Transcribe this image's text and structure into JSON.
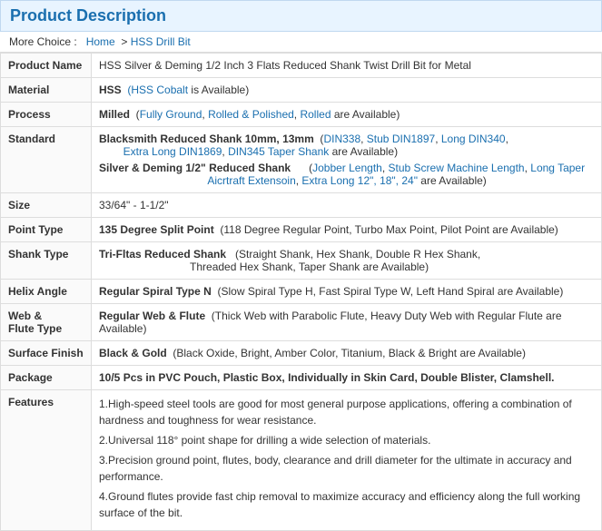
{
  "header": {
    "title": "Product Description"
  },
  "breadcrumb": {
    "prefix": "More Choice :",
    "links": [
      {
        "label": "Home",
        "href": "#"
      },
      {
        "label": "HSS Drill Bit",
        "href": "#"
      }
    ]
  },
  "specs": [
    {
      "label": "Product Name",
      "value": "HSS Silver & Deming 1/2 Inch 3 Flats Reduced Shank Twist Drill Bit for Metal"
    },
    {
      "label": "Material",
      "main": "HSS",
      "detail": "(HSS Cobalt is Available)"
    },
    {
      "label": "Process",
      "main": "Milled",
      "detail": "(Fully Ground, Rolled & Polished, Rolled are Available)"
    },
    {
      "label": "Standard",
      "line1_main": "Blacksmith Reduced Shank 10mm, 13mm",
      "line1_detail": "(DIN338, Stub DIN1897, Long DIN340, Extra Long DIN1869, DIN345 Taper Shank are Available)",
      "line2_main": "Silver & Deming 1/2\" Reduced Shank",
      "line2_detail": "(Jobber Length, Stub Screw Machine Length, Long Taper Aicrtraft Extensoin, Extra Long 12\", 18\", 24\" are Available)"
    },
    {
      "label": "Size",
      "value": "33/64\" - 1-1/2\""
    },
    {
      "label": "Point Type",
      "main": "135 Degree Split Point",
      "detail": "(118 Degree Regular Point, Turbo Max Point, Pilot Point are Available)"
    },
    {
      "label": "Shank Type",
      "main": "Tri-Fltas Reduced Shank",
      "detail": "(Straight Shank, Hex Shank, Double R Hex Shank, Threaded Hex Shank, Taper Shank are Available)"
    },
    {
      "label": "Helix Angle",
      "main": "Regular Spiral Type N",
      "detail": "(Slow Spiral Type H, Fast Spiral Type W, Left Hand Spiral are Available)"
    },
    {
      "label": "Web & Flute Type",
      "main": "Regular Web & Flute",
      "detail": "(Thick Web with Parabolic Flute, Heavy Duty Web with Regular Flute are Available)"
    },
    {
      "label": "Surface Finish",
      "main": "Black & Gold",
      "detail": "(Black Oxide, Bright, Amber Color, Titanium, Black & Bright are Available)"
    },
    {
      "label": "Package",
      "value": "10/5 Pcs in PVC Pouch, Plastic Box, Individually in Skin Card, Double Blister, Clamshell."
    }
  ],
  "features": {
    "label": "Features",
    "items": [
      "1.High-speed steel tools are good for most general purpose applications, offering a combination of hardness and toughness for wear resistance.",
      "2.Universal 118° point shape for drilling a wide selection of materials.",
      "3.Precision ground point, flutes, body, clearance and drill diameter for the ultimate in accuracy and performance.",
      "4.Ground flutes provide fast chip removal to maximize accuracy and efficiency along the full working surface of the bit."
    ]
  }
}
